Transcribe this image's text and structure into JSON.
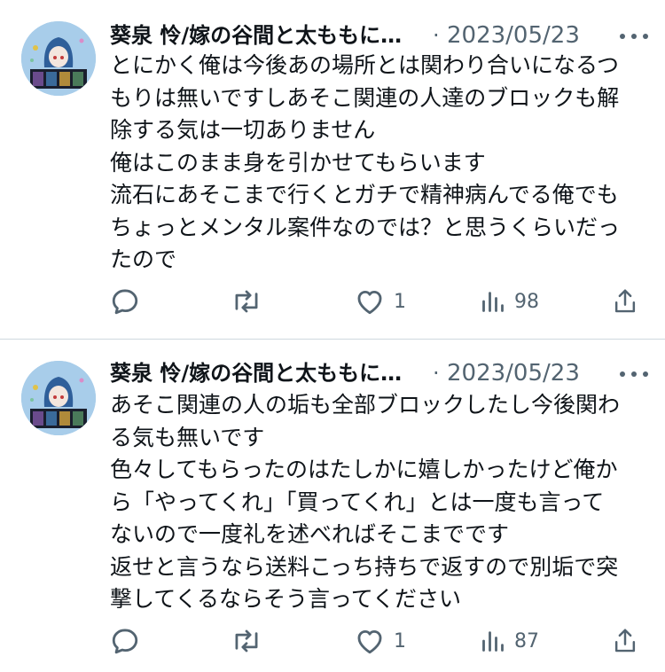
{
  "tweets": [
    {
      "author": "葵泉 怜/嫁の谷間と太ももに…",
      "separator": "·",
      "date": "2023/05/23",
      "lines": [
        "とにかく俺は今後あの場所とは関わり合いになるつ",
        "もりは無いですしあそこ関連の人達のブロックも解",
        "除する気は一切ありません",
        "俺はこのまま身を引かせてもらいます",
        "流石にあそこまで行くとガチで精神病んでる俺でも",
        "ちょっとメンタル案件なのでは？と思うくらいだっ",
        "たので"
      ],
      "likes": "1",
      "views": "98"
    },
    {
      "author": "葵泉 怜/嫁の谷間と太ももに…",
      "separator": "·",
      "date": "2023/05/23",
      "lines": [
        "あそこ関連の人の垢も全部ブロックしたし今後関わ",
        "る気も無いです",
        "色々してもらったのはたしかに嬉しかったけど俺か",
        "ら「やってくれ」「買ってくれ」とは一度も言って",
        "ないので一度礼を述べればそこまでです",
        "返せと言うなら送料こっち持ちで返すので別垢で突",
        "撃してくるならそう言ってください"
      ],
      "likes": "1",
      "views": "87"
    }
  ],
  "icons": {
    "reply": "reply-icon",
    "retweet": "retweet-icon",
    "like": "heart-icon",
    "views": "views-icon",
    "share": "share-icon",
    "more": "more-icon"
  },
  "colors": {
    "text": "#0f1419",
    "secondary": "#536471",
    "divider": "#cfd9de",
    "avatar_bg": "#9fc6e6"
  }
}
